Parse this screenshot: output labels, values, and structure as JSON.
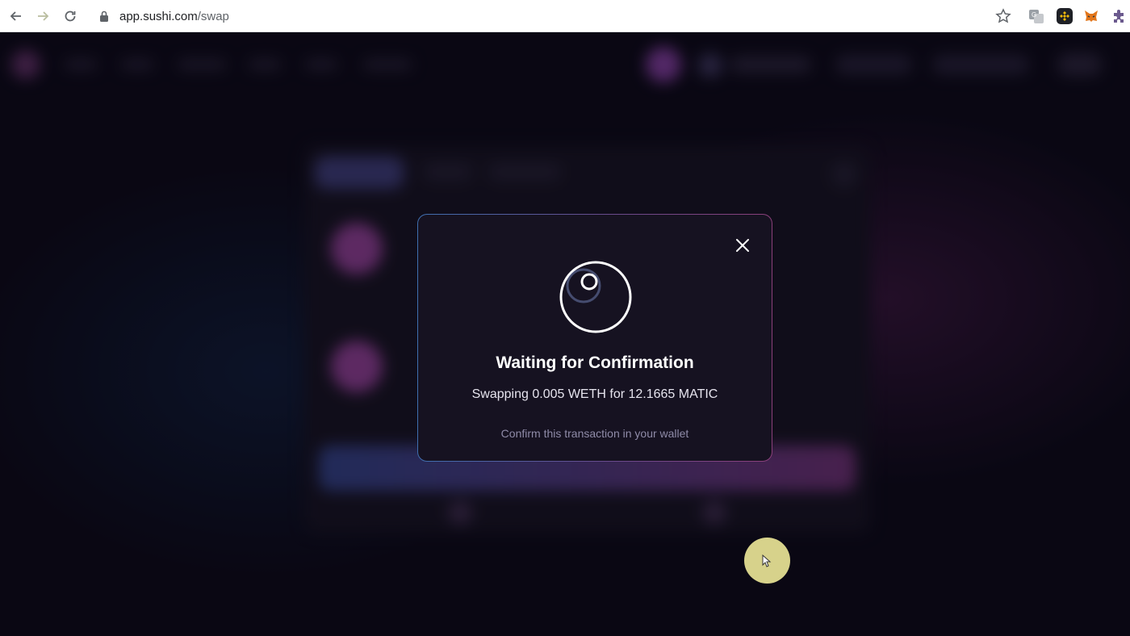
{
  "browser": {
    "url_host": "app.sushi.com",
    "url_path": "/swap",
    "icons": [
      "back-arrow-icon",
      "forward-arrow-icon",
      "reload-icon",
      "lock-icon",
      "star-icon",
      "translate-extension-icon",
      "binance-extension-icon",
      "metamask-extension-icon",
      "extensions-puzzle-icon"
    ]
  },
  "modal": {
    "title": "Waiting for Confirmation",
    "subtitle": "Swapping 0.005 WETH for 12.1665 MATIC",
    "hint": "Confirm this transaction in your wallet",
    "icons": [
      "close-icon",
      "loading-spinner-icon"
    ]
  },
  "colors": {
    "page_background": "#0b0915",
    "modal_background": "#161221",
    "modal_border_blue": "#3f6fb0",
    "modal_border_pink": "#8a3f7a",
    "cursor_highlight": "#d7d28b"
  }
}
